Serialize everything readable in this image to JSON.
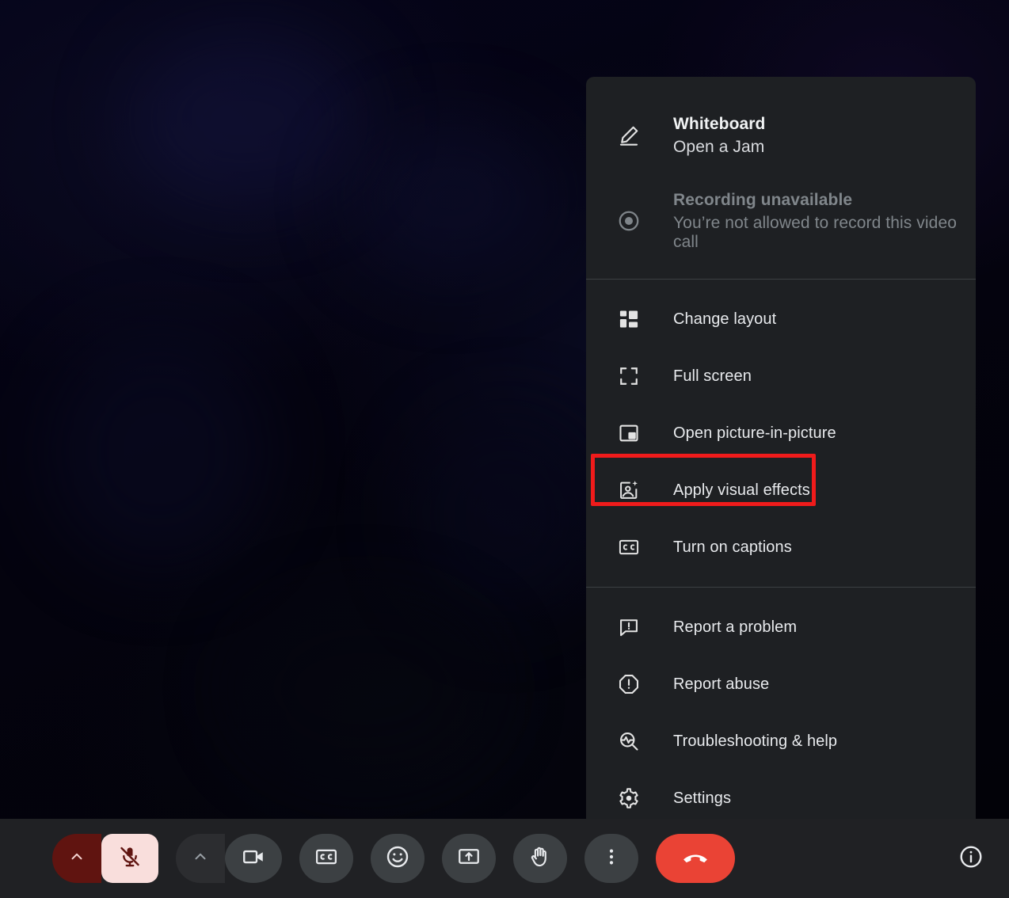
{
  "colors": {
    "menu_bg": "#1e2023",
    "bar_bg": "#202124",
    "divider": "#3c4043",
    "text": "#e8eaed",
    "text_disabled": "#80868b",
    "highlight": "#f01b1b",
    "end_call": "#ea4335",
    "mic_muted_bg": "#f9dedc",
    "mic_muted_fg": "#601410"
  },
  "menu": {
    "sections": [
      {
        "items": [
          {
            "icon": "pencil-icon",
            "title": "Whiteboard",
            "subtitle": "Open a Jam",
            "disabled": false,
            "name": "menu-item-whiteboard"
          },
          {
            "icon": "record-icon",
            "title": "Recording unavailable",
            "subtitle": "You’re not allowed to record this video call",
            "disabled": true,
            "name": "menu-item-recording"
          }
        ]
      },
      {
        "items": [
          {
            "icon": "layout-icon",
            "label": "Change layout",
            "name": "menu-item-change-layout"
          },
          {
            "icon": "fullscreen-icon",
            "label": "Full screen",
            "name": "menu-item-full-screen"
          },
          {
            "icon": "pip-icon",
            "label": "Open picture-in-picture",
            "name": "menu-item-picture-in-picture"
          },
          {
            "icon": "visual-effects-icon",
            "label": "Apply visual effects",
            "name": "menu-item-apply-visual-effects",
            "highlighted": true
          },
          {
            "icon": "captions-icon",
            "label": "Turn on captions",
            "name": "menu-item-turn-on-captions"
          }
        ]
      },
      {
        "items": [
          {
            "icon": "report-problem-icon",
            "label": "Report a problem",
            "name": "menu-item-report-a-problem"
          },
          {
            "icon": "report-abuse-icon",
            "label": "Report abuse",
            "name": "menu-item-report-abuse"
          },
          {
            "icon": "troubleshooting-icon",
            "label": "Troubleshooting & help",
            "name": "menu-item-troubleshooting-help"
          },
          {
            "icon": "gear-icon",
            "label": "Settings",
            "name": "menu-item-settings"
          }
        ]
      }
    ]
  },
  "toolbar": {
    "mic": {
      "icon": "mic-off-icon",
      "state": "muted",
      "chevron": "chevron-up-icon"
    },
    "camera": {
      "icon": "video-camera-icon",
      "state": "on",
      "chevron": "chevron-up-icon"
    },
    "buttons": [
      {
        "icon": "captions-cc-icon",
        "name": "captions-button"
      },
      {
        "icon": "emoji-icon",
        "name": "emoji-reactions-button"
      },
      {
        "icon": "present-screen-icon",
        "name": "present-now-button"
      },
      {
        "icon": "raise-hand-icon",
        "name": "raise-hand-button"
      },
      {
        "icon": "more-vertical-icon",
        "name": "more-options-button",
        "highlighted": true
      }
    ],
    "end_call": {
      "icon": "end-call-icon",
      "name": "leave-call-button"
    },
    "info": {
      "icon": "info-icon",
      "name": "meeting-details-button"
    }
  }
}
